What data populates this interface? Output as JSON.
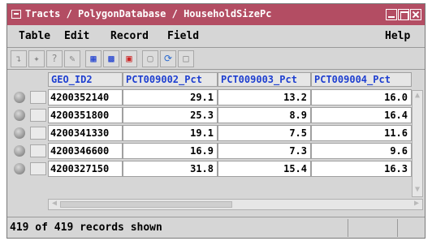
{
  "window": {
    "title": "Tracts / PolygonDatabase / HouseholdSizePc"
  },
  "menu": {
    "items": [
      "Table",
      "Edit",
      "Record",
      "Field"
    ],
    "help": "Help"
  },
  "toolbar": {
    "icons": [
      "single-record-icon",
      "select-icon",
      "help-query-icon",
      "edit-icon",
      "table-color-icon",
      "table-select-icon",
      "table-all-icon",
      "save-icon",
      "refresh-icon",
      "export-icon"
    ]
  },
  "table": {
    "columns": [
      "GEO_ID2",
      "PCT009002_Pct",
      "PCT009003_Pct",
      "PCT009004_Pct"
    ],
    "rows": [
      [
        "4200352140",
        "29.1",
        "13.2",
        "16.0"
      ],
      [
        "4200351800",
        "25.3",
        "8.9",
        "16.4"
      ],
      [
        "4200341330",
        "19.1",
        "7.5",
        "11.6"
      ],
      [
        "4200346600",
        "16.9",
        "7.3",
        "9.6"
      ],
      [
        "4200327150",
        "31.8",
        "15.4",
        "16.3"
      ]
    ]
  },
  "status": {
    "text": "419 of 419 records shown"
  },
  "colors": {
    "titlebar": "#b34d63",
    "header_text": "#1e3fd0"
  }
}
